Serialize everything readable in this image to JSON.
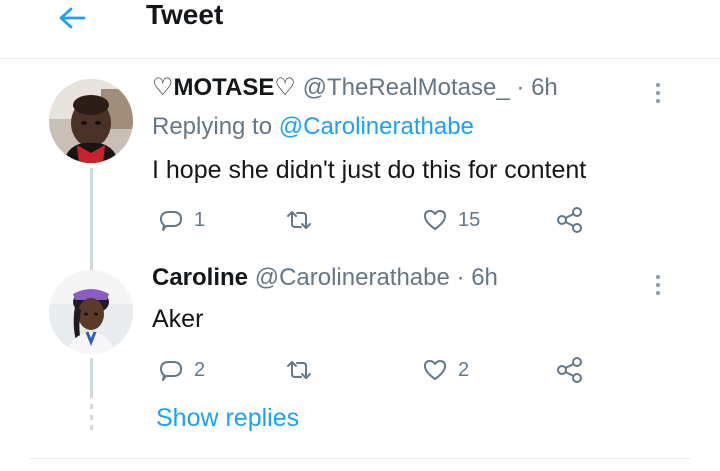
{
  "header": {
    "title": "Tweet",
    "back_icon": "arrow-left-icon",
    "accent": "#1da1f2"
  },
  "tweets": [
    {
      "display_name": "♡MOTASE♡",
      "handle": "@TheRealMotase_",
      "separator": "·",
      "time": "6h",
      "replying_to_label": "Replying to",
      "replying_to_handle": "@Carolinerathabe",
      "text": "I hope she didn't just do this for content",
      "reply_count": "1",
      "retweet_count": "",
      "like_count": "15"
    },
    {
      "display_name": "Caroline",
      "handle": "@Carolinerathabe",
      "separator": "·",
      "time": "6h",
      "text": "Aker",
      "reply_count": "2",
      "retweet_count": "",
      "like_count": "2"
    }
  ],
  "show_replies_label": "Show replies",
  "colors": {
    "link": "#1da1f2",
    "secondary_text": "#657786",
    "primary_text": "#14171a",
    "thread_line": "#cfd9de"
  }
}
